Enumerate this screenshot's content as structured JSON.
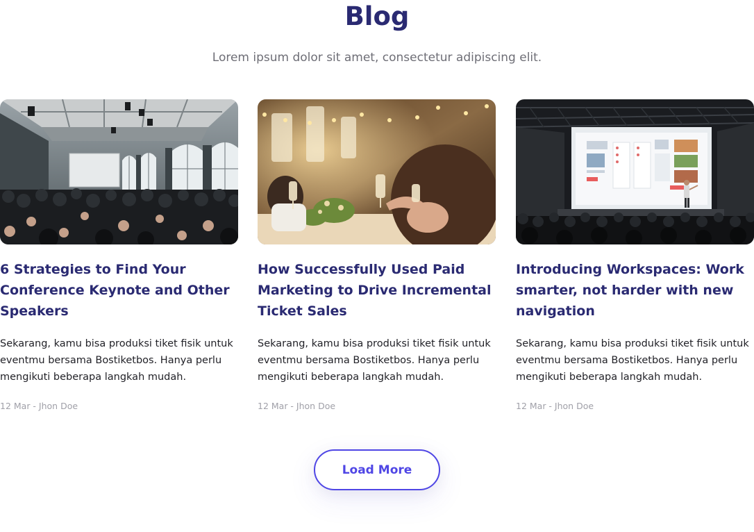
{
  "section": {
    "title": "Blog",
    "subtitle": "Lorem ipsum dolor sit amet, consectetur adipiscing elit."
  },
  "posts": [
    {
      "title": "6 Strategies to Find Your Conference Keynote and Other Speakers",
      "excerpt": "Sekarang, kamu bisa produksi tiket fisik untuk eventmu bersama Bostiketbos. Hanya perlu mengikuti beberapa langkah mudah.",
      "meta": "12 Mar - Jhon Doe"
    },
    {
      "title": "How Successfully Used Paid Marketing to Drive Incremental Ticket Sales",
      "excerpt": "Sekarang, kamu bisa produksi tiket fisik untuk eventmu bersama Bostiketbos. Hanya perlu mengikuti beberapa langkah mudah.",
      "meta": "12 Mar - Jhon Doe"
    },
    {
      "title": "Introducing Workspaces: Work smarter, not harder with new navigation",
      "excerpt": "Sekarang, kamu bisa produksi tiket fisik untuk eventmu bersama Bostiketbos. Hanya perlu mengikuti beberapa langkah mudah.",
      "meta": "12 Mar - Jhon Doe"
    }
  ],
  "load_more": {
    "label": "Load More"
  },
  "colors": {
    "heading": "#2a2a72",
    "accent": "#4f46e5",
    "muted": "#a0a0a8"
  }
}
